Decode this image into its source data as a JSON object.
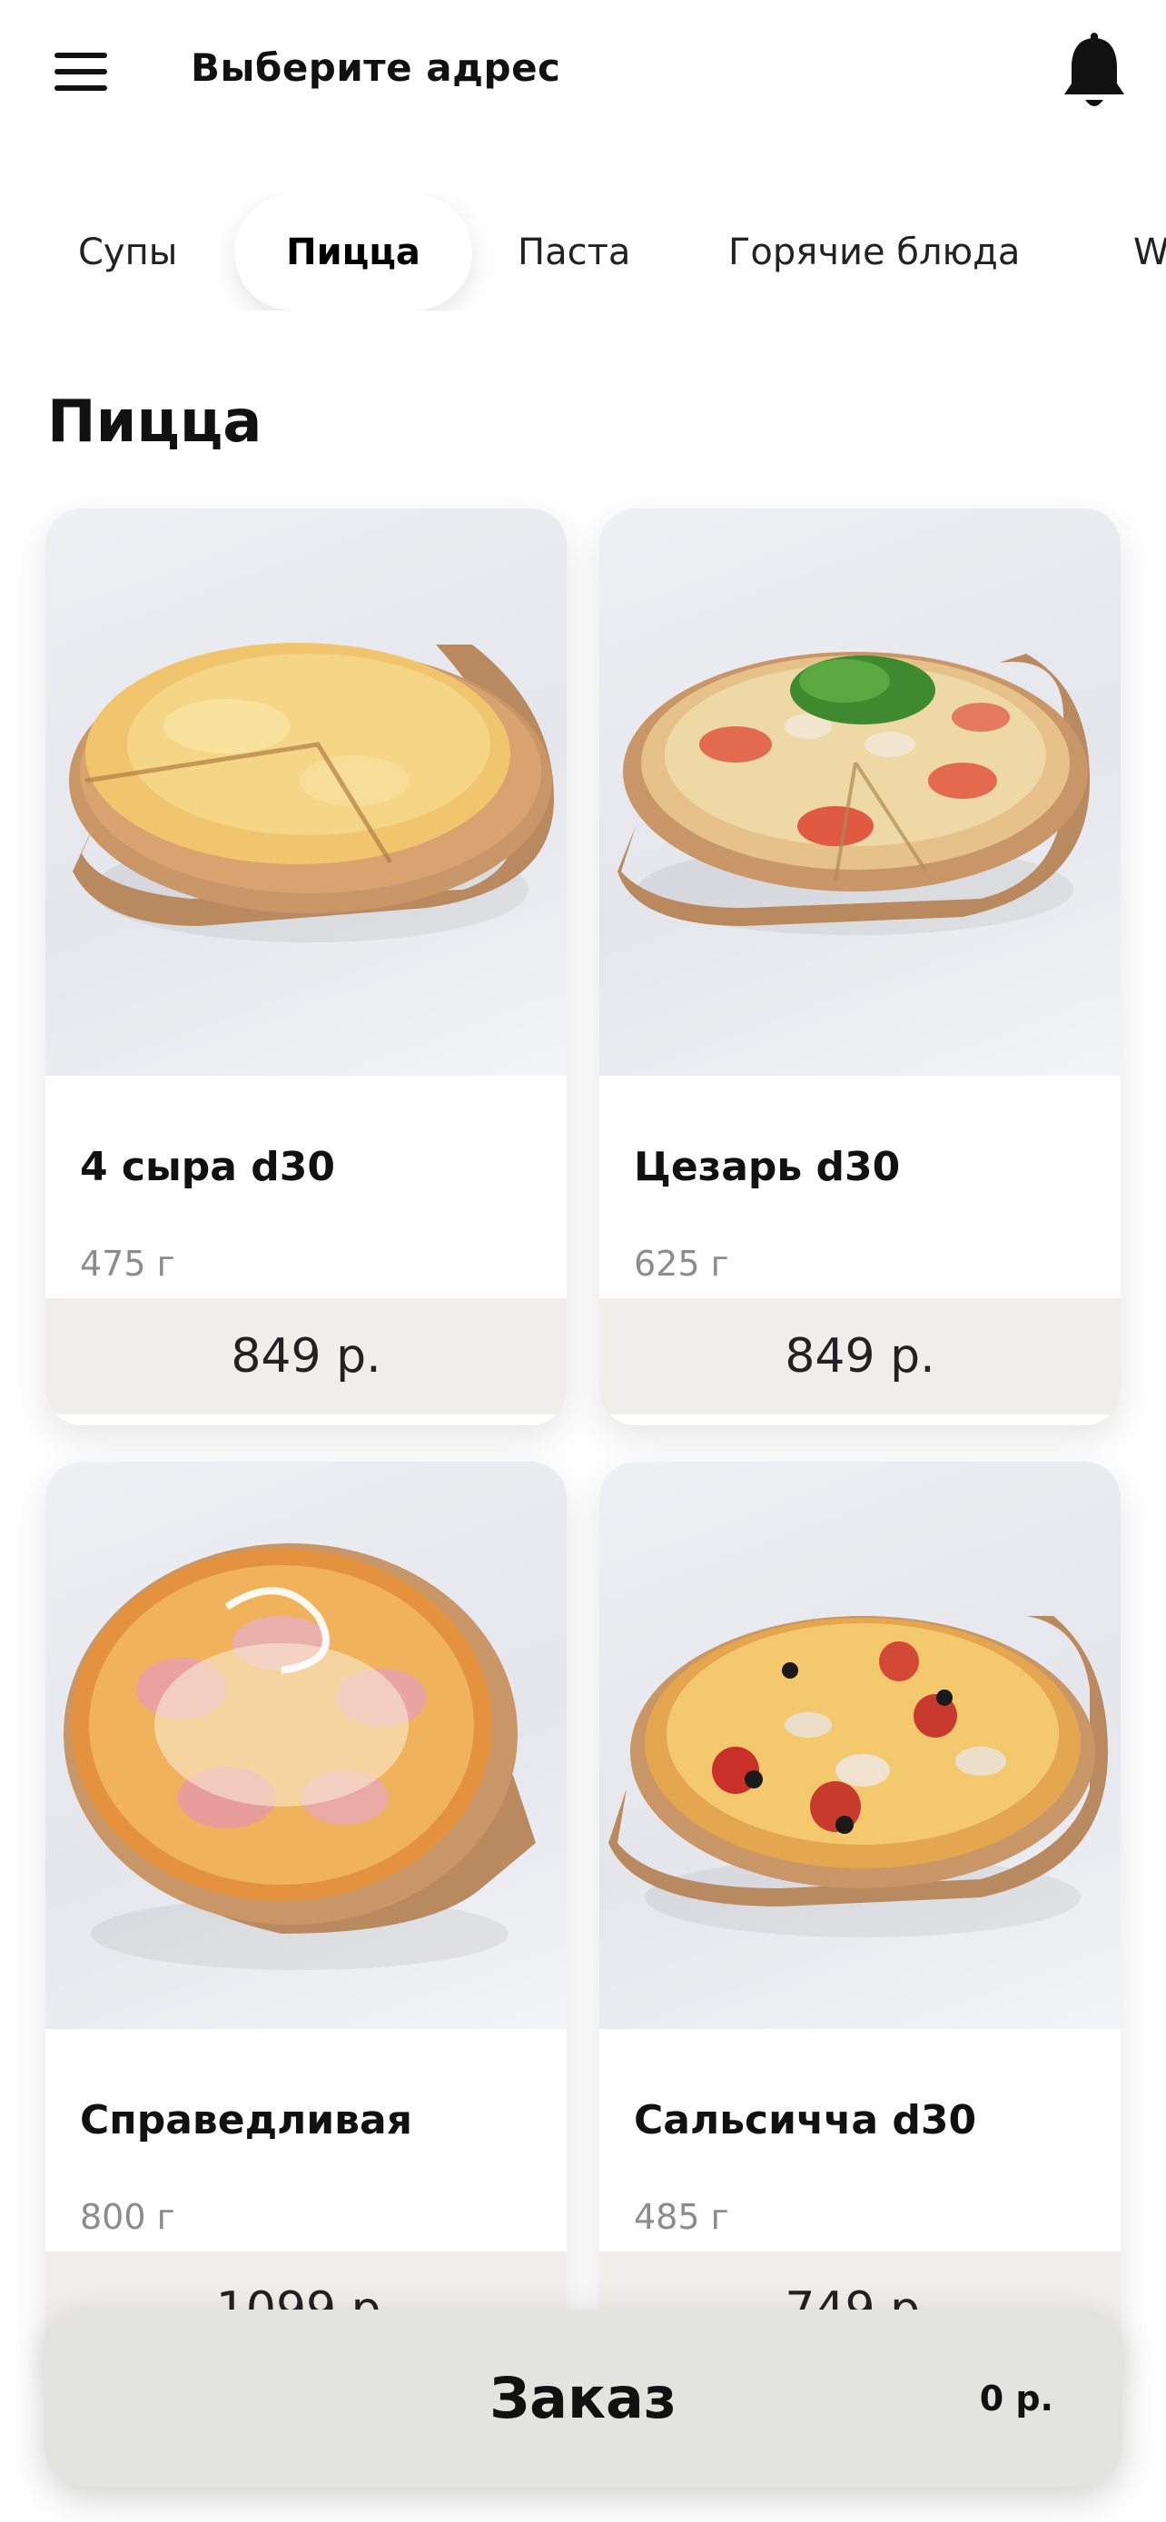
{
  "header": {
    "address_label": "Выберите адрес"
  },
  "tabs": [
    {
      "label": "Супы",
      "active": false
    },
    {
      "label": "Пицца",
      "active": true
    },
    {
      "label": "Паста",
      "active": false
    },
    {
      "label": "Горячие блюда",
      "active": false
    },
    {
      "label": "W",
      "active": false
    }
  ],
  "section": {
    "title": "Пицца"
  },
  "products": [
    {
      "name": "4 сыра d30",
      "weight": "475 г",
      "price": "849 р.",
      "image": "pizza-four-cheese"
    },
    {
      "name": "Цезарь d30",
      "weight": "625 г",
      "price": "849 р.",
      "image": "pizza-caesar"
    },
    {
      "name": "Справедливая",
      "weight": "800 г",
      "price": "1099 р.",
      "image": "pizza-ham"
    },
    {
      "name": "Сальсичча d30",
      "weight": "485 г",
      "price": "749 р.",
      "image": "pizza-salsiccia"
    }
  ],
  "order_bar": {
    "label": "Заказ",
    "sum": "0 р."
  },
  "colors": {
    "background": "#ffffff",
    "price_bar": "#efeeeb",
    "order_bar": "#e3e4e0",
    "text": "#111111",
    "muted": "#8c8c8c"
  }
}
